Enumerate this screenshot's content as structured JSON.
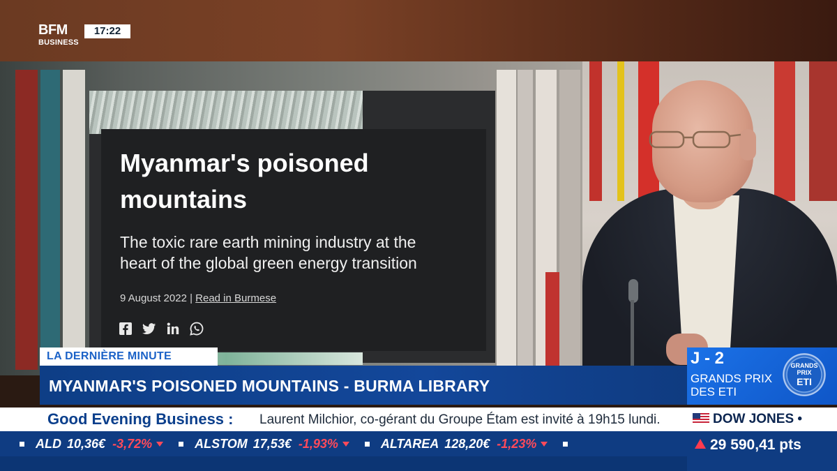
{
  "channel": {
    "logo_line1": "BFM",
    "logo_line2": "BUSINESS",
    "clock": "17:22"
  },
  "article": {
    "title_line1": "Myanmar's poisoned",
    "title_line2": "mountains",
    "subtitle_line1": "The toxic rare earth mining industry at the",
    "subtitle_line2": "heart of the global green energy transition",
    "date": "9 August 2022",
    "separator": " | ",
    "read_link": "Read in Burmese",
    "social_icons": [
      "facebook-icon",
      "twitter-icon",
      "linkedin-icon",
      "whatsapp-icon"
    ]
  },
  "lower_third": {
    "tag": "LA DERNIÈRE MINUTE",
    "headline": "MYANMAR'S POISONED MOUNTAINS - BURMA LIBRARY"
  },
  "promo": {
    "countdown": "J - 2",
    "line1": "GRANDS PRIX",
    "line2": "DES ETI",
    "badge_line1": "GRANDS",
    "badge_line2": "PRIX",
    "badge_line3": "ETI"
  },
  "news_ticker": {
    "show": "Good Evening Business :",
    "text": "Laurent Milchior, co-gérant du Groupe Étam est invité à 19h15 lundi."
  },
  "index": {
    "name": "DOW JONES",
    "suffix": "•",
    "value": "29 590,41 pts",
    "trend_color": "#ff3b4e"
  },
  "stocks": [
    {
      "name": "ALD",
      "value": "10,36€",
      "change": "-3,72%"
    },
    {
      "name": "ALSTOM",
      "value": "17,53€",
      "change": "-1,93%"
    },
    {
      "name": "ALTAREA",
      "value": "128,20€",
      "change": "-1,23%"
    }
  ],
  "colors": {
    "headline_blue": "#13479a",
    "accent_blue": "#1b62c7",
    "negative": "#ff4a5a"
  }
}
